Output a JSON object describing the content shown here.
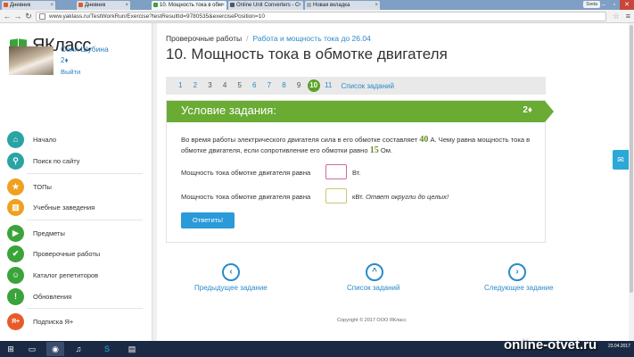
{
  "browser": {
    "tabs": [
      {
        "label": "Дневник",
        "active": false
      },
      {
        "label": "Дневник",
        "active": false
      },
      {
        "label": "10. Мощность тока в обм",
        "active": true
      },
      {
        "label": "Online Unit Converters - С",
        "active": false
      },
      {
        "label": "Новая вкладка",
        "active": false
      }
    ],
    "user_badge": "Sveta",
    "url": "www.yaklass.ru/TestWorkRun/Exercise?testResultId=9780535&exercisePosition=10"
  },
  "sidebar": {
    "logo": "ЯКласс",
    "user_name": "Соня Шубина",
    "user_score": "2♦",
    "logout": "Выйти",
    "items": [
      {
        "label": "Начало",
        "icon": "home-icon",
        "color": "#2aa3a3",
        "glyph": "⌂"
      },
      {
        "label": "Поиск по сайту",
        "icon": "search-icon",
        "color": "#2aa3a3",
        "glyph": "⚲"
      },
      {
        "label": "ТОПы",
        "icon": "star-icon",
        "color": "#f0a020",
        "glyph": "★"
      },
      {
        "label": "Учебные заведения",
        "icon": "school-icon",
        "color": "#f0a020",
        "glyph": "▥"
      },
      {
        "label": "Предметы",
        "icon": "video-icon",
        "color": "#3aa43a",
        "glyph": "▶"
      },
      {
        "label": "Проверочные работы",
        "icon": "check-icon",
        "color": "#3aa43a",
        "glyph": "✔"
      },
      {
        "label": "Каталог репетиторов",
        "icon": "person-icon",
        "color": "#3aa43a",
        "glyph": "☺"
      },
      {
        "label": "Обновления",
        "icon": "exclamation-icon",
        "color": "#3aa43a",
        "glyph": "!"
      },
      {
        "label": "Подписка Я+",
        "icon": "plus-icon",
        "color": "#e85a2a",
        "glyph": "Я+"
      }
    ]
  },
  "main": {
    "breadcrumb": {
      "root": "Проверочные работы",
      "separator": "/",
      "current": "Работа и мощность тока до 26.04"
    },
    "title": "10. Мощность тока в обмотке двигателя",
    "pager": {
      "pages": [
        "1",
        "2",
        "3",
        "4",
        "5",
        "6",
        "7",
        "8",
        "9",
        "10",
        "11"
      ],
      "done": [
        "3",
        "4",
        "5",
        "9"
      ],
      "current": "10",
      "list_label": "Список заданий"
    },
    "card": {
      "header": "Условие задания:",
      "points": "2♦",
      "text_1": "Во время работы электрического двигателя сила в его обмотке составляет ",
      "current_value": "40",
      "text_2": " А. Чему равна мощность тока в обмотке двигателя, если  сопротивление его обмотки равно ",
      "resistance_value": "15",
      "text_3": " Ом.",
      "q1_label": "Мощность тока обмотке двигателя равна",
      "q1_unit": "Вт.",
      "q2_label": "Мощность тока обмотке двигателя равна",
      "q2_unit": "кВт.",
      "q2_hint": "Ответ округли до целых!",
      "answer_button": "Ответить!"
    },
    "bottom_nav": {
      "prev": "Предыдущее задание",
      "list": "Список заданий",
      "next": "Следующее задание"
    },
    "copyright": "Copyright © 2017 ООО ЯКласс"
  },
  "taskbar": {
    "watermark": "online-otvet.ru",
    "date": "23.04.2017"
  }
}
